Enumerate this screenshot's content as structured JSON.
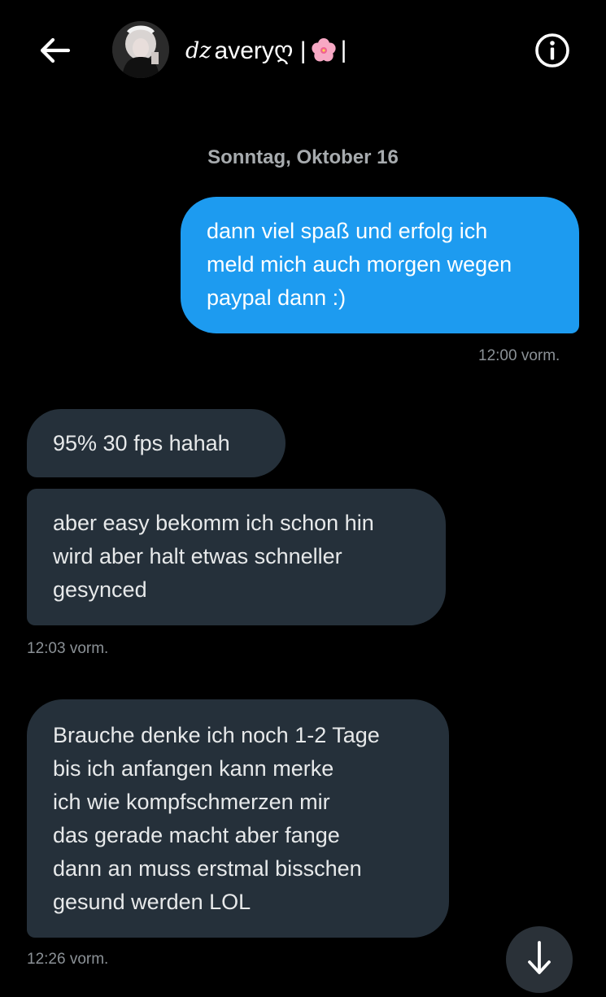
{
  "header": {
    "back_icon": "arrow-left-icon",
    "contact_name_prefix": "dz",
    "contact_name": "averyღ | ",
    "contact_name_emoji": "cherry-blossom-icon",
    "contact_name_suffix": "|",
    "info_icon": "info-circle-icon"
  },
  "conversation": {
    "date_separator": "Sonntag, Oktober 16",
    "messages": [
      {
        "direction": "sent",
        "text": "dann viel spaß und erfolg ich\nmeld mich auch morgen wegen\npaypal dann :)",
        "timestamp": "12:00 vorm."
      },
      {
        "direction": "received",
        "text": "95% 30 fps hahah"
      },
      {
        "direction": "received",
        "text": "aber easy bekomm ich schon hin\nwird aber halt etwas schneller\ngesynced",
        "timestamp": "12:03 vorm."
      },
      {
        "direction": "received",
        "text": "Brauche denke ich noch 1-2 Tage\nbis ich anfangen kann merke\nich wie kompfschmerzen mir\ndas gerade macht aber fange\ndann an muss erstmal bisschen\ngesund werden LOL",
        "timestamp": "12:26 vorm."
      }
    ]
  },
  "scroll_down_icon": "arrow-down-icon",
  "colors": {
    "background": "#000000",
    "sent_bubble": "#1d9bf0",
    "received_bubble": "#25303a",
    "timestamp": "#8b9196"
  }
}
